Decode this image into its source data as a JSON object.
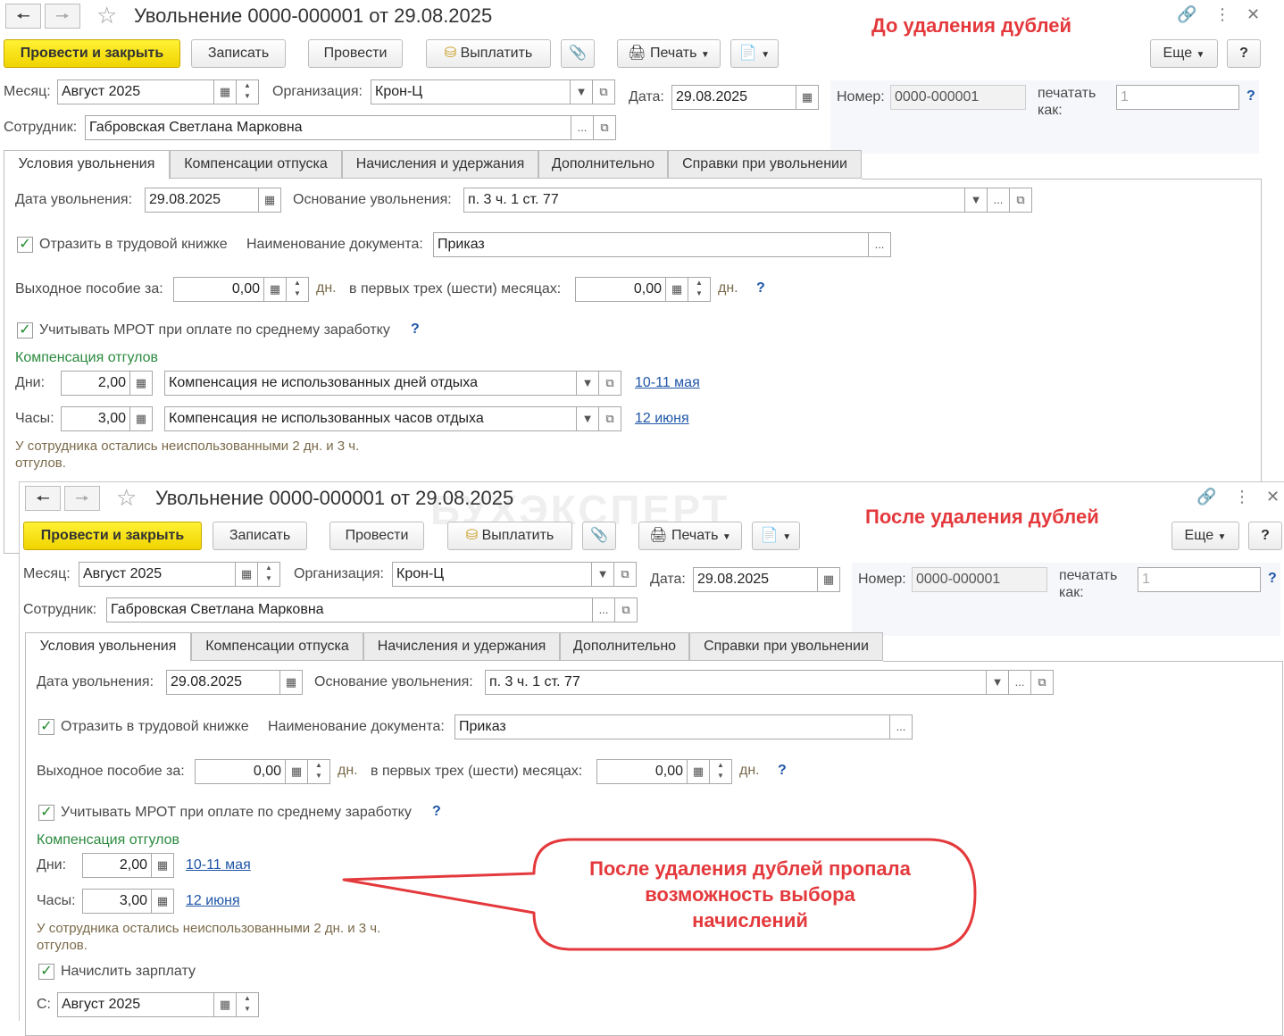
{
  "annotations": {
    "before": "До удаления дублей",
    "after": "После удаления дублей",
    "callout": [
      "После удаления дублей пропала",
      "возможность выбора",
      "начислений"
    ],
    "watermark": "БУХЭКСПЕРТ"
  },
  "doc": {
    "title": "Увольнение 0000-000001 от 29.08.2025",
    "toolbar": {
      "post_close": "Провести и закрыть",
      "save": "Записать",
      "post": "Провести",
      "pay": "Выплатить",
      "print": "Печать",
      "more": "Еще",
      "help": "?"
    },
    "header": {
      "month_label": "Месяц:",
      "month": "Август 2025",
      "org_label": "Организация:",
      "org": "Крон-Ц",
      "date_label": "Дата:",
      "date": "29.08.2025",
      "number_label": "Номер:",
      "number": "0000-000001",
      "print_as_label_1": "печатать",
      "print_as_label_2": "как:",
      "print_as_placeholder": "1",
      "employee_label": "Сотрудник:",
      "employee": "Габровская Светлана Марковна"
    },
    "tabs": [
      "Условия увольнения",
      "Компенсации отпуска",
      "Начисления и удержания",
      "Дополнительно",
      "Справки при увольнении"
    ],
    "terms": {
      "dismissal_date_label": "Дата увольнения:",
      "dismissal_date": "29.08.2025",
      "basis_label": "Основание увольнения:",
      "basis": "п. 3 ч. 1 ст. 77",
      "workbook_label": "Отразить в трудовой книжке",
      "doc_name_label": "Наименование документа:",
      "doc_name": "Приказ",
      "severance_label": "Выходное пособие за:",
      "severance": "0,00",
      "days_unit": "дн.",
      "first_months_label": "в первых трех (шести) месяцах:",
      "first_months": "0,00",
      "mrot_label": "Учитывать МРОТ при оплате по среднему заработку",
      "comp_title": "Компенсация отгулов",
      "days_label": "Дни:",
      "days": "2,00",
      "days_accrual": "Компенсация не использованных дней отдыха",
      "days_link": "10-11 мая",
      "hours_label": "Часы:",
      "hours": "3,00",
      "hours_accrual": "Компенсация не использованных часов отдыха",
      "hours_link": "12 июня",
      "remaining_note_1": "У сотрудника остались неиспользованными 2 дн. и 3 ч.",
      "remaining_note_2": "отгулов.",
      "salary_label": "Начислить зарплату",
      "from_label": "С:",
      "from_month": "Август 2025"
    }
  },
  "icons": {
    "back": "arrow-left-icon",
    "forward": "arrow-right-icon",
    "favorite": "star-icon",
    "link": "link-icon",
    "menu": "kebab-menu-icon",
    "close": "close-icon",
    "calendar": "calendar-icon",
    "calculator": "calculator-icon",
    "open": "open-form-icon",
    "dropdown": "chevron-down-icon",
    "attach": "paperclip-icon",
    "printer": "printer-icon",
    "coins": "coins-icon",
    "ellipsis": "ellipsis-icon"
  },
  "colors": {
    "accent_yellow": "#f7e21f",
    "annotation_red": "#e4393c",
    "link_blue": "#1f56a8",
    "section_green": "#2b8a3e"
  }
}
